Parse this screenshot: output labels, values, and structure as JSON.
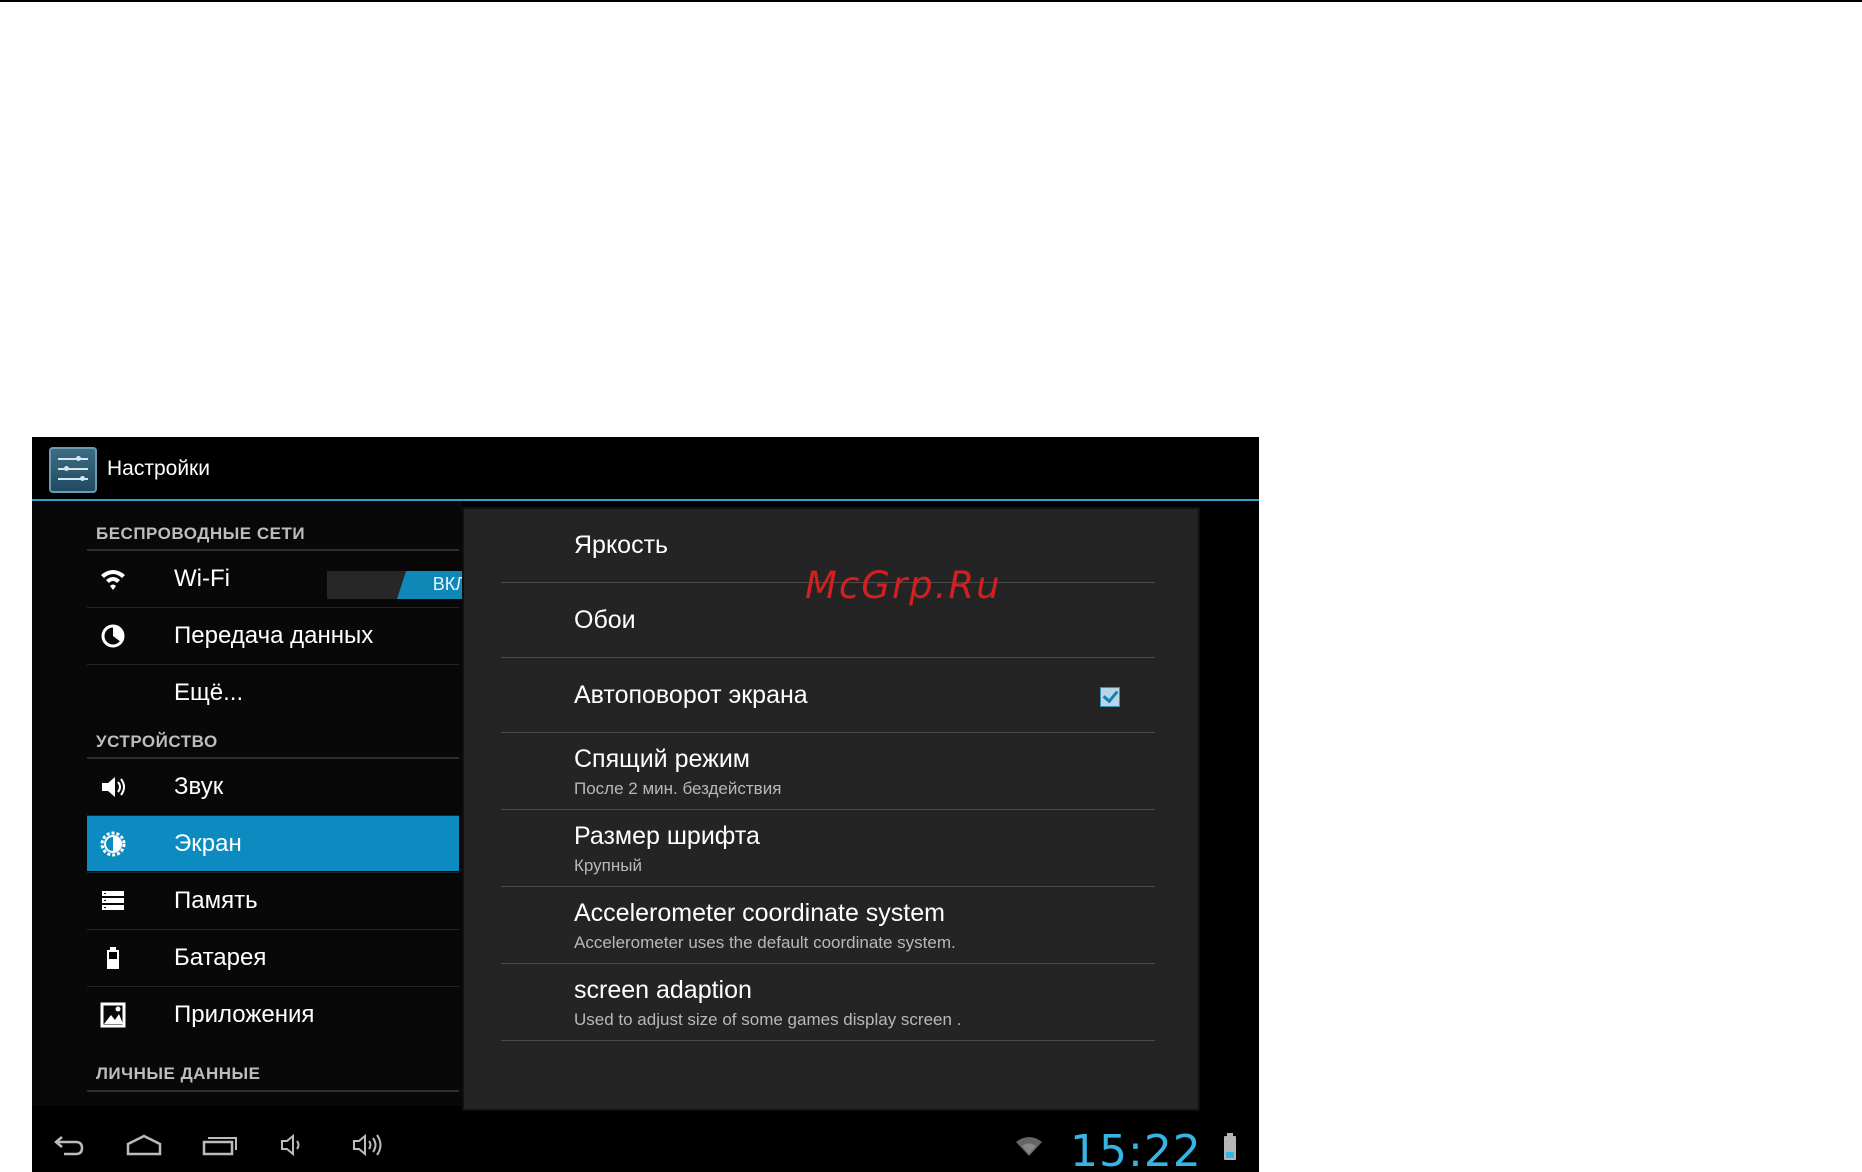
{
  "action_bar": {
    "title": "Настройки",
    "icon": "settings-icon"
  },
  "sidebar": {
    "categories": {
      "wireless": "БЕСПРОВОДНЫЕ СЕТИ",
      "device": "УСТРОЙСТВО",
      "personal": "ЛИЧНЫЕ ДАННЫЕ"
    },
    "items": [
      {
        "label": "Wi-Fi",
        "icon": "wifi-icon",
        "toggle": "ВКЛ"
      },
      {
        "label": "Передача данных",
        "icon": "data-usage-icon"
      },
      {
        "label": "Ещё...",
        "icon": ""
      },
      {
        "label": "Звук",
        "icon": "speaker-icon"
      },
      {
        "label": "Экран",
        "icon": "brightness-icon",
        "selected": true
      },
      {
        "label": "Память",
        "icon": "storage-icon"
      },
      {
        "label": "Батарея",
        "icon": "battery-icon"
      },
      {
        "label": "Приложения",
        "icon": "apps-icon"
      }
    ]
  },
  "detail": {
    "rows": [
      {
        "title": "Яркость"
      },
      {
        "title": "Обои"
      },
      {
        "title": "Автоповорот экрана",
        "checked": true
      },
      {
        "title": "Спящий режим",
        "summary": "После 2 мин. бездействия"
      },
      {
        "title": "Размер шрифта",
        "summary": "Крупный"
      },
      {
        "title": "Accelerometer coordinate system",
        "summary": "Accelerometer uses the default coordinate system."
      },
      {
        "title": "screen adaption",
        "summary": "Used to adjust size of some games display screen ."
      }
    ]
  },
  "watermark": "McGrp.Ru",
  "system_bar": {
    "clock": "15:22",
    "battery_level": 0.3,
    "accent_color": "#36b4e5"
  },
  "colors": {
    "accent": "#33a0c8",
    "selected": "#0b8bc0",
    "watermark": "#d31f1f"
  }
}
